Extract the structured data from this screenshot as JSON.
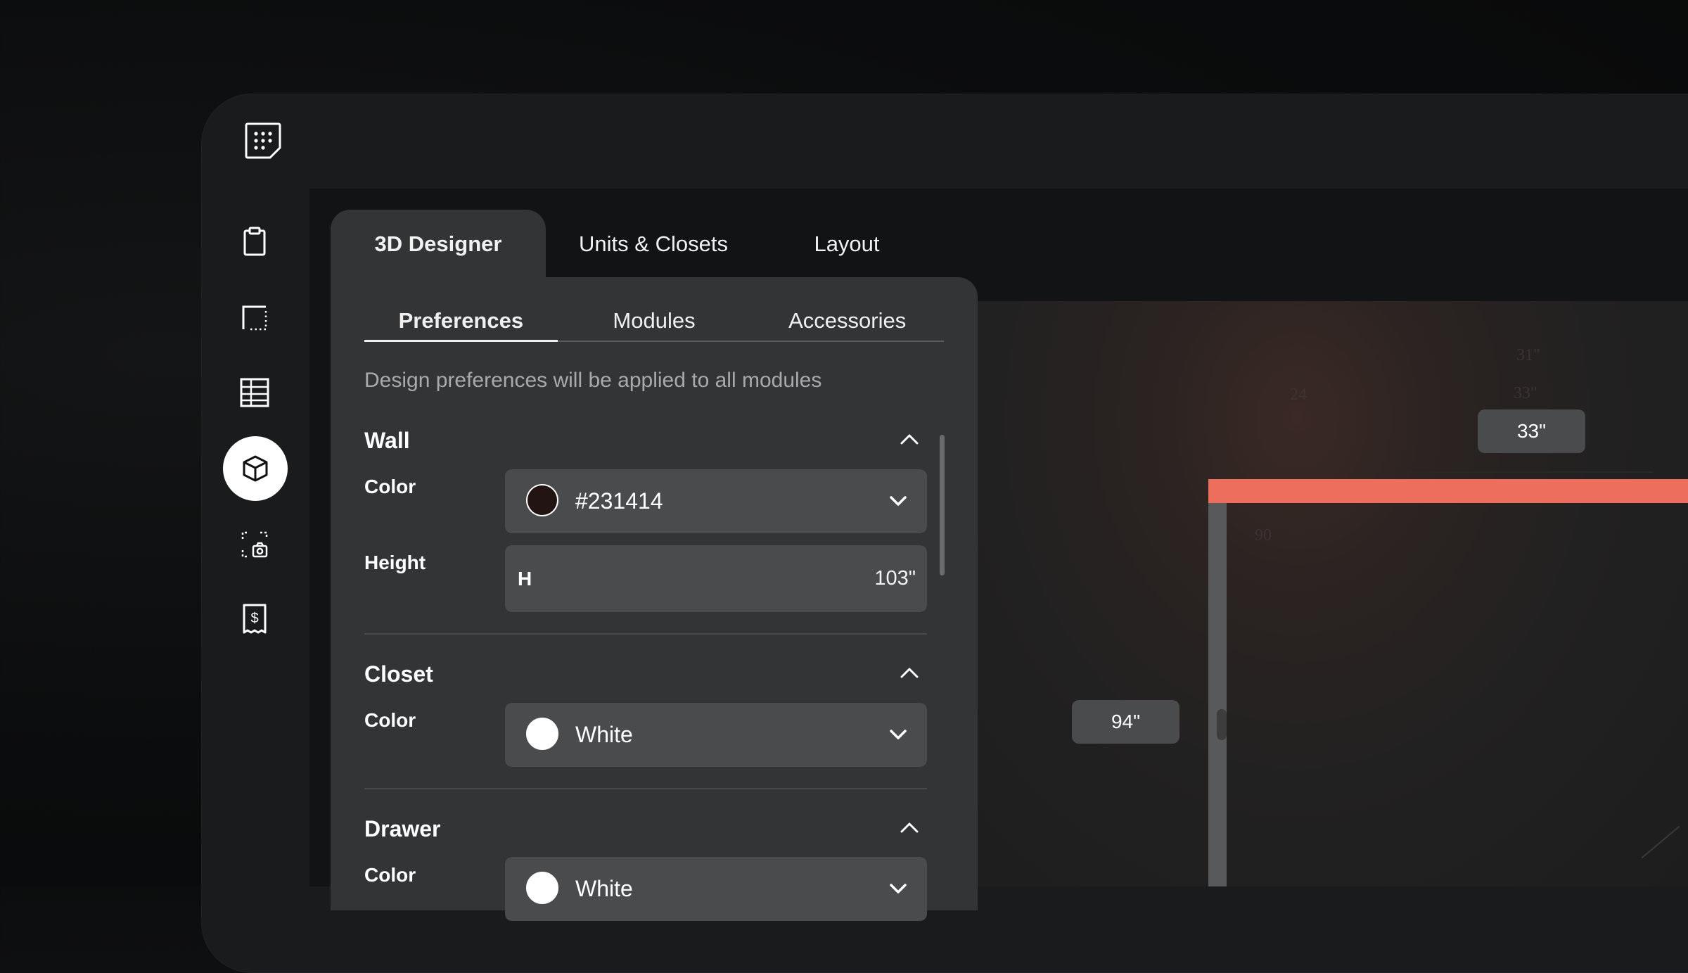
{
  "colors": {
    "accent_wall": "#ee6e5e",
    "panel": "#333435",
    "field": "#4a4b4c"
  },
  "sidebar": {
    "logo_icon": "grid-logo-icon",
    "items": [
      {
        "icon": "clipboard-icon",
        "active": false
      },
      {
        "icon": "floor-plan-icon",
        "active": false
      },
      {
        "icon": "table-icon",
        "active": false
      },
      {
        "icon": "cube-icon",
        "active": true
      },
      {
        "icon": "camera-icon",
        "active": false
      },
      {
        "icon": "receipt-dollar-icon",
        "active": false
      }
    ]
  },
  "tabs": [
    {
      "label": "3D Designer",
      "active": true
    },
    {
      "label": "Units & Closets",
      "active": false
    },
    {
      "label": "Layout",
      "active": false
    }
  ],
  "subtabs": [
    {
      "label": "Preferences",
      "active": true
    },
    {
      "label": "Modules",
      "active": false
    },
    {
      "label": "Accessories",
      "active": false
    }
  ],
  "hint": "Design preferences will be applied to all modules",
  "wall": {
    "title": "Wall",
    "color_label": "Color",
    "color_value": "#231414",
    "swatch": "#231414",
    "height_label": "Height",
    "height_prefix": "H",
    "height_value": "103\""
  },
  "closet": {
    "title": "Closet",
    "color_label": "Color",
    "color_value": "White",
    "swatch": "#ffffff"
  },
  "drawer": {
    "title": "Drawer",
    "color_label": "Color",
    "color_value": "White",
    "swatch": "#ffffff"
  },
  "canvas": {
    "dim_top": "33\"",
    "dim_left": "94\"",
    "faint_labels": [
      "31\"",
      "33\"",
      "24",
      "90"
    ]
  }
}
